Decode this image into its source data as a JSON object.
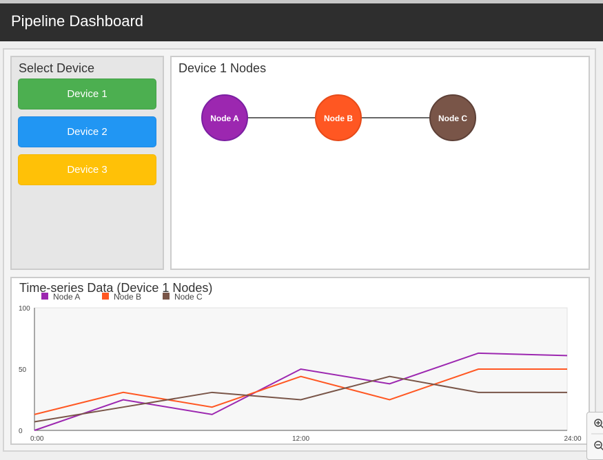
{
  "header": {
    "title": "Pipeline Dashboard"
  },
  "sidebar": {
    "title": "Select Device",
    "devices": [
      {
        "label": "Device 1",
        "color": "#4caf50"
      },
      {
        "label": "Device 2",
        "color": "#2196f3"
      },
      {
        "label": "Device 3",
        "color": "#ffc107"
      }
    ]
  },
  "nodes_panel": {
    "title": "Device 1 Nodes",
    "nodes": [
      {
        "label": "Node A",
        "color": "#9c27b0"
      },
      {
        "label": "Node B",
        "color": "#ff5722"
      },
      {
        "label": "Node C",
        "color": "#795548"
      }
    ]
  },
  "chart_panel": {
    "title": "Time-series Data (Device 1 Nodes)"
  },
  "chart_data": {
    "type": "line",
    "x": [
      0,
      4,
      8,
      12,
      16,
      20,
      24
    ],
    "xticks": [
      "0:00",
      "12:00",
      "24:00"
    ],
    "xtick_values": [
      0,
      12,
      24
    ],
    "yticks": [
      "0",
      "50",
      "100"
    ],
    "ytick_values": [
      0,
      50,
      100
    ],
    "ylim": [
      0,
      100
    ],
    "xlim": [
      0,
      24
    ],
    "legend_position": "top-left",
    "series": [
      {
        "name": "Node A",
        "color": "#9c27b0",
        "values": [
          0,
          25,
          13,
          50,
          38,
          63,
          61
        ]
      },
      {
        "name": "Node B",
        "color": "#ff5722",
        "values": [
          13,
          31,
          19,
          44,
          25,
          50,
          50
        ]
      },
      {
        "name": "Node C",
        "color": "#795548",
        "values": [
          7,
          19,
          31,
          25,
          44,
          31,
          31
        ]
      }
    ],
    "plot_background": "#f7f7f7"
  },
  "zoom_controls": {
    "zoom_in_icon": "zoom-in-icon",
    "zoom_out_icon": "zoom-out-icon"
  }
}
